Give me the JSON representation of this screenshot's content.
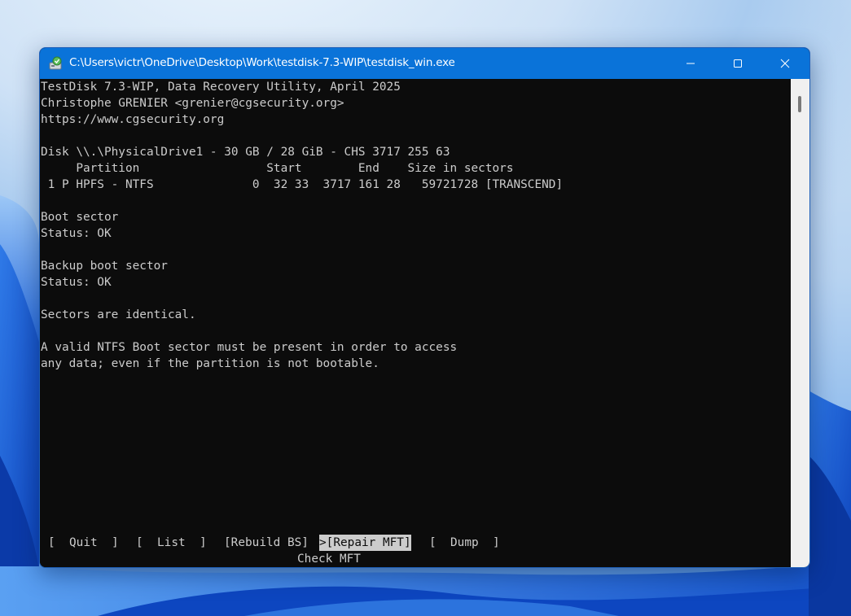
{
  "window": {
    "title": "C:\\Users\\victr\\OneDrive\\Desktop\\Work\\testdisk-7.3-WIP\\testdisk_win.exe"
  },
  "console": {
    "header": [
      "TestDisk 7.3-WIP, Data Recovery Utility, April 2025",
      "Christophe GRENIER <grenier@cgsecurity.org>",
      "https://www.cgsecurity.org"
    ],
    "disk_line": "Disk \\\\.\\PhysicalDrive1 - 30 GB / 28 GiB - CHS 3717 255 63",
    "partition_header": "     Partition                  Start        End    Size in sectors",
    "partition_row": " 1 P HPFS - NTFS              0  32 33  3717 161 28   59721728 [TRANSCEND]",
    "boot_sector_label": "Boot sector",
    "boot_sector_status": "Status: OK",
    "backup_boot_sector_label": "Backup boot sector",
    "backup_boot_sector_status": "Status: OK",
    "sectors_message": "Sectors are identical.",
    "info_line1": "A valid NTFS Boot sector must be present in order to access",
    "info_line2": "any data; even if the partition is not bootable."
  },
  "menu": {
    "quit": "[  Quit  ]",
    "list": "[  List  ]",
    "rebuild_bs": "[Rebuild BS]",
    "repair_mft_cursor": ">",
    "repair_mft": "[Repair MFT]",
    "dump": "[  Dump  ]",
    "hint": "Check MFT"
  },
  "icons": {
    "app": "testdisk-app-icon",
    "minimize": "minimize-icon",
    "maximize": "maximize-icon",
    "close": "close-icon"
  },
  "colors": {
    "titlebar": "#0a73d9",
    "console_bg": "#0c0c0c",
    "console_fg": "#cccccc",
    "selected_bg": "#cccccc"
  }
}
